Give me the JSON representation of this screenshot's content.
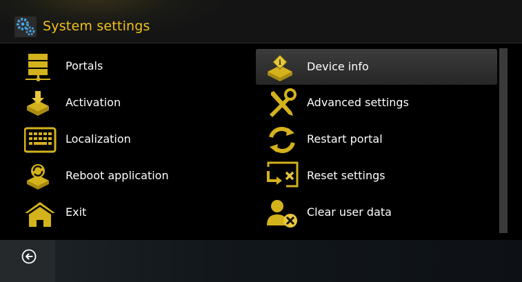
{
  "header": {
    "title": "System settings",
    "icon": "gears-icon"
  },
  "colors": {
    "accent": "#f2c21b",
    "icon_gold": "#d4b21c"
  },
  "left_menu": [
    {
      "label": "Portals",
      "icon": "server-icon"
    },
    {
      "label": "Activation",
      "icon": "download-box-icon"
    },
    {
      "label": "Localization",
      "icon": "keyboard-icon"
    },
    {
      "label": "Reboot application",
      "icon": "reboot-icon"
    },
    {
      "label": "Exit",
      "icon": "home-icon"
    }
  ],
  "right_menu": [
    {
      "label": "Device info",
      "icon": "device-info-icon",
      "selected": true
    },
    {
      "label": "Advanced settings",
      "icon": "tools-icon"
    },
    {
      "label": "Restart portal",
      "icon": "refresh-icon"
    },
    {
      "label": "Reset settings",
      "icon": "reset-icon"
    },
    {
      "label": "Clear user data",
      "icon": "user-remove-icon"
    }
  ],
  "footer": {
    "back_icon": "back-icon"
  }
}
